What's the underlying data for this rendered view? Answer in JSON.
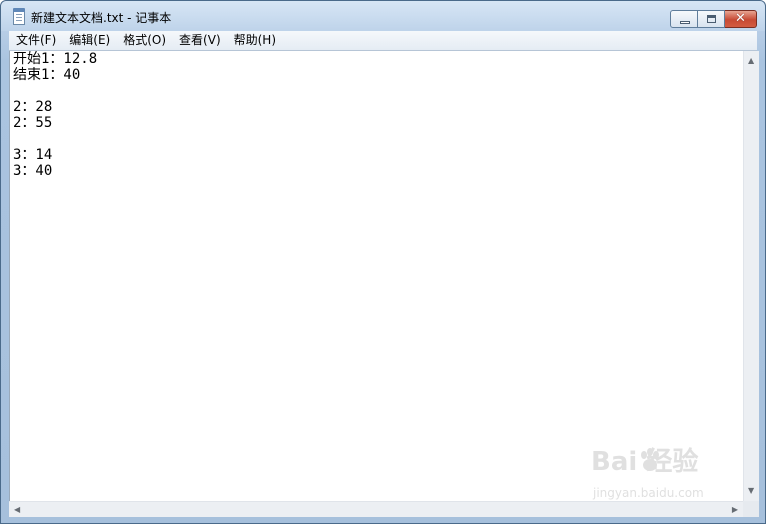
{
  "window": {
    "title": "新建文本文档.txt - 记事本"
  },
  "menu": {
    "items": [
      {
        "label": "文件(F)"
      },
      {
        "label": "编辑(E)"
      },
      {
        "label": "格式(O)"
      },
      {
        "label": "查看(V)"
      },
      {
        "label": "帮助(H)"
      }
    ]
  },
  "editor": {
    "lines": [
      "开始1：12.8",
      "结束1：40",
      "",
      "2：28",
      "2：55",
      "",
      "3：14",
      "3：40"
    ]
  },
  "watermark": {
    "logo_text": "Bai 经验",
    "sub_text": "jingyan.baidu.com"
  },
  "icons": {
    "app": "notepad-icon",
    "minimize": "minimize-icon",
    "maximize": "maximize-icon",
    "close": "close-icon"
  }
}
